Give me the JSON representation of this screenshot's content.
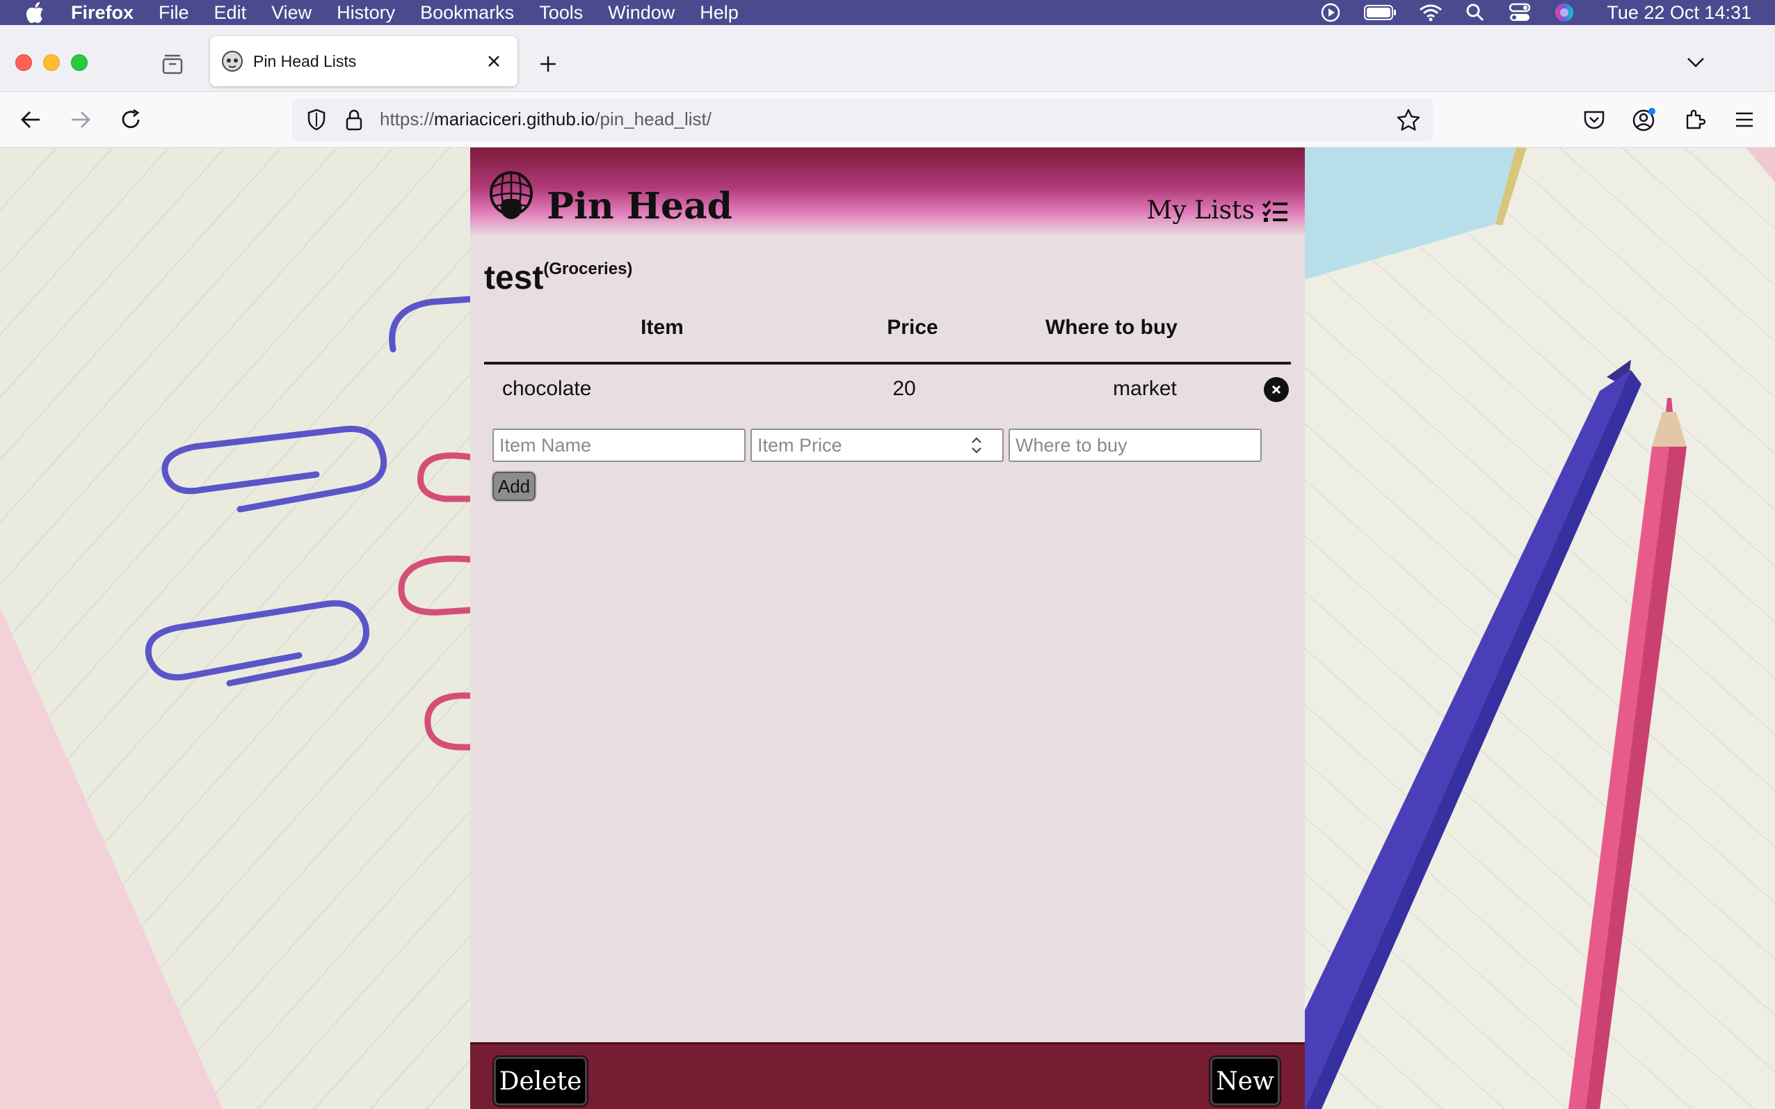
{
  "menubar": {
    "app": "Firefox",
    "items": [
      "File",
      "Edit",
      "View",
      "History",
      "Bookmarks",
      "Tools",
      "Window",
      "Help"
    ],
    "clock": "Tue 22 Oct  14:31",
    "status_icons": [
      "play-icon",
      "battery-icon",
      "wifi-icon",
      "spotlight-icon",
      "control-center-icon",
      "siri-icon"
    ]
  },
  "browser": {
    "tab_title": "Pin Head Lists",
    "url_prefix": "https://",
    "url_host": "mariaciceri.github.io",
    "url_path": "/pin_head_list/"
  },
  "app": {
    "brand": "Pin Head",
    "my_lists_label": "My Lists",
    "list_name": "test",
    "list_category": "(Groceries)",
    "columns": [
      "Item",
      "Price",
      "Where to buy"
    ],
    "rows": [
      {
        "item": "chocolate",
        "price": "20",
        "where": "market"
      }
    ],
    "form": {
      "item_placeholder": "Item Name",
      "price_placeholder": "Item Price",
      "where_placeholder": "Where to buy",
      "add_label": "Add"
    },
    "footer": {
      "delete_label": "Delete",
      "new_label": "New"
    }
  },
  "colors": {
    "header_dark": "#7c1c3b",
    "header_pink": "#e07ab8",
    "panel_bg": "#e9dedf",
    "footer_bg": "#761d33",
    "menubar_bg": "#4a4a8e"
  }
}
